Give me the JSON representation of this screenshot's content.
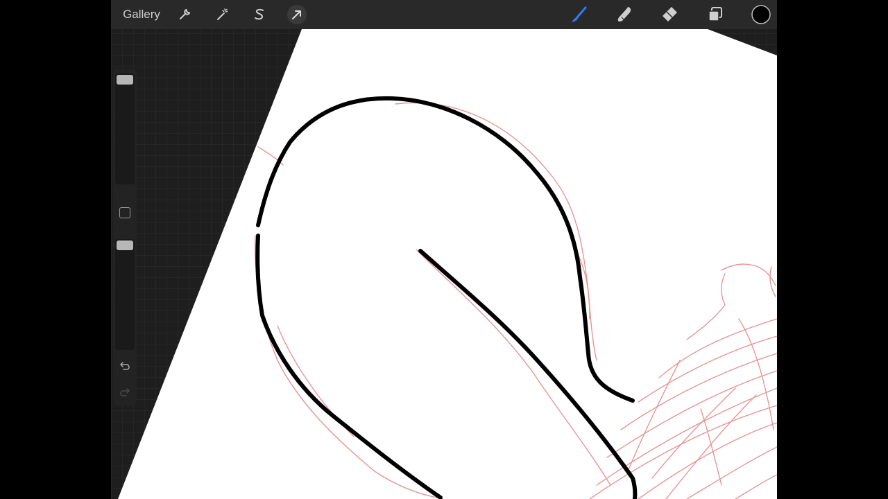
{
  "toolbar": {
    "gallery_label": "Gallery",
    "actions_icon": "wrench-icon",
    "adjustments_icon": "magic-wand-icon",
    "selection_icon": "selection-s-icon",
    "transform_icon": "arrow-cursor-icon",
    "brush_icon": "paintbrush-icon",
    "smudge_icon": "smudge-finger-icon",
    "eraser_icon": "eraser-icon",
    "layers_icon": "layers-icon",
    "color_icon": "color-circle-icon"
  },
  "colors": {
    "active_tool": "#2f7cf6",
    "current_color": "#000000",
    "sketch_line": "#e07a7a",
    "ink_line": "#000000",
    "interface_bg": "#2a2a2a"
  },
  "sidebar": {
    "brush_size_icon": "size-slider",
    "opacity_icon": "opacity-slider",
    "modify_icon": "square-modify-icon",
    "undo_icon": "undo-arrow-icon",
    "redo_icon": "redo-arrow-icon"
  }
}
